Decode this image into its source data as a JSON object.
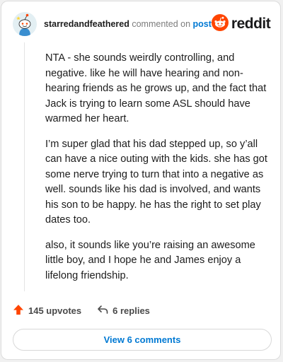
{
  "comment": {
    "username": "starredandfeathered",
    "commented_text": "commented on",
    "post_link": "post",
    "brand": "reddit",
    "paragraphs": [
      "NTA - she sounds weirdly controlling, and negative. like he will have hearing and non-hearing friends as he grows up, and the fact that Jack is trying to learn some ASL should have warmed her heart.",
      "I’m super glad that his dad stepped up, so y’all can have a nice outing with the kids. she has got some nerve trying to turn that into a negative as well. sounds like his dad is involved, and wants his son to be happy. he has the right to set play dates too.",
      "also, it sounds like you’re raising an awesome little boy, and I hope he and James enjoy a lifelong friendship."
    ],
    "upvotes": "145 upvotes",
    "replies": "6 replies",
    "view_comments": "View 6 comments"
  },
  "icons": {
    "avatar": "snoo-avatar",
    "logo": "reddit-logo-icon",
    "upvote": "upvote-arrow-icon",
    "reply": "reply-arrow-icon"
  },
  "colors": {
    "reddit_orange": "#ff4500",
    "link_blue": "#0079d3",
    "upvote_orange": "#ff4500"
  }
}
